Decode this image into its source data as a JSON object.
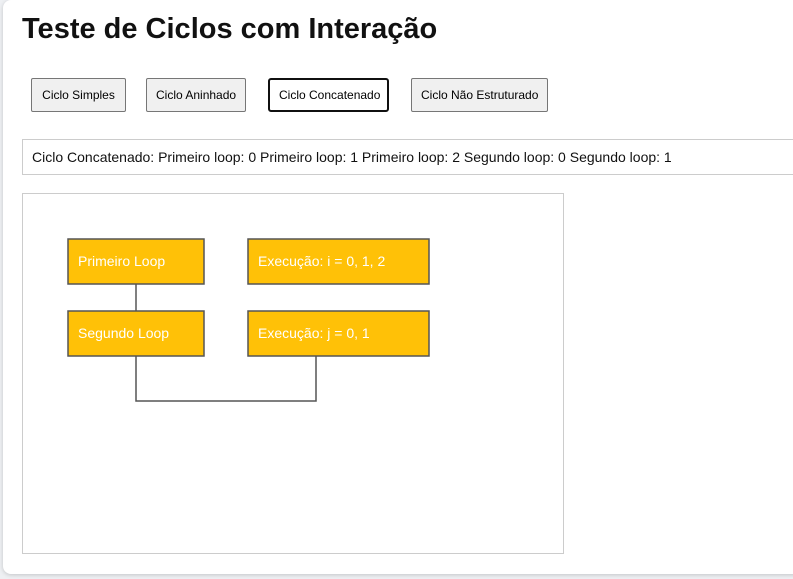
{
  "page": {
    "title": "Teste de Ciclos com Interação"
  },
  "buttons": [
    {
      "label": "Ciclo Simples"
    },
    {
      "label": "Ciclo Aninhado"
    },
    {
      "label": "Ciclo Concatenado",
      "active": true
    },
    {
      "label": "Ciclo Não Estruturado"
    }
  ],
  "output": {
    "text": "Ciclo Concatenado: Primeiro loop: 0 Primeiro loop: 1 Primeiro loop: 2 Segundo loop: 0 Segundo loop: 1"
  },
  "diagram": {
    "nodes": {
      "loop1": "Primeiro Loop",
      "exec1": "Execução: i = 0, 1, 2",
      "loop2": "Segundo Loop",
      "exec2": "Execução: j = 0, 1"
    },
    "colors": {
      "node_fill": "#ffc107",
      "node_stroke": "#555555",
      "edge": "#555555"
    }
  }
}
